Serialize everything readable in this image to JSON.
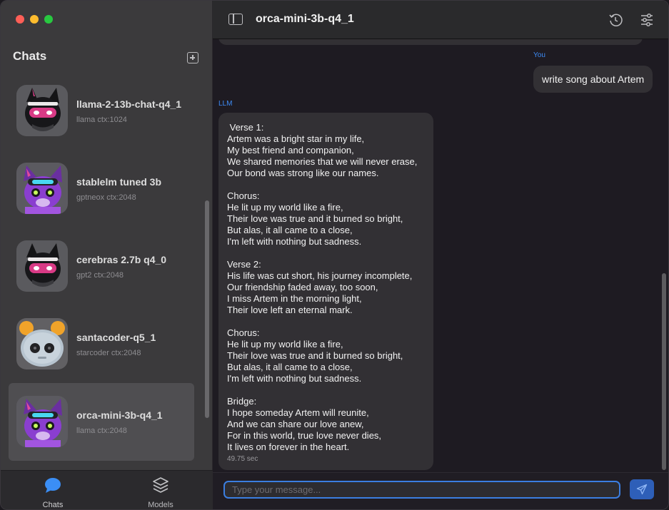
{
  "sidebar": {
    "title": "Chats",
    "chats": [
      {
        "name": "llama-2-13b-chat-q4_1",
        "sub": "llama ctx:1024",
        "avatar": "dark-ninja-cat-avatar"
      },
      {
        "name": "stablelm tuned 3b",
        "sub": "gptneox ctx:2048",
        "avatar": "purple-cyber-cat-avatar"
      },
      {
        "name": "cerebras 2.7b q4_0",
        "sub": "gpt2 ctx:2048",
        "avatar": "dark-ninja-cat-avatar"
      },
      {
        "name": "santacoder-q5_1",
        "sub": "starcoder ctx:2048",
        "avatar": "knitted-robot-avatar"
      },
      {
        "name": "orca-mini-3b-q4_1",
        "sub": "llama ctx:2048",
        "avatar": "purple-cyber-cat-avatar",
        "selected": true
      }
    ],
    "tabs": {
      "chats": "Chats",
      "models": "Models"
    }
  },
  "header": {
    "title": "orca-mini-3b-q4_1"
  },
  "conversation": {
    "user_sender": "You",
    "user_message": "write song about Artem",
    "llm_sender": "LLM",
    "llm_message": " Verse 1:\nArtem was a bright star in my life,\nMy best friend and companion,\nWe shared memories that we will never erase,\nOur bond was strong like our names.\n\nChorus:\nHe lit up my world like a fire,\nTheir love was true and it burned so bright,\nBut alas, it all came to a close,\nI'm left with nothing but sadness.\n\nVerse 2:\nHis life was cut short, his journey incomplete,\nOur friendship faded away, too soon,\nI miss Artem in the morning light,\nTheir love left an eternal mark.\n\nChorus:\nHe lit up my world like a fire,\nTheir love was true and it burned so bright,\nBut alas, it all came to a close,\nI'm left with nothing but sadness.\n\nBridge:\nI hope someday Artem will reunite,\nAnd we can share our love anew,\nFor in this world, true love never dies,\nIt lives on forever in the heart.",
    "llm_time": "49.75 sec"
  },
  "input": {
    "placeholder": "Type your message...",
    "value": ""
  },
  "colors": {
    "accent": "#3d8bf5",
    "send_button": "#2e5fb8",
    "selected_row": "#4f4e51"
  }
}
